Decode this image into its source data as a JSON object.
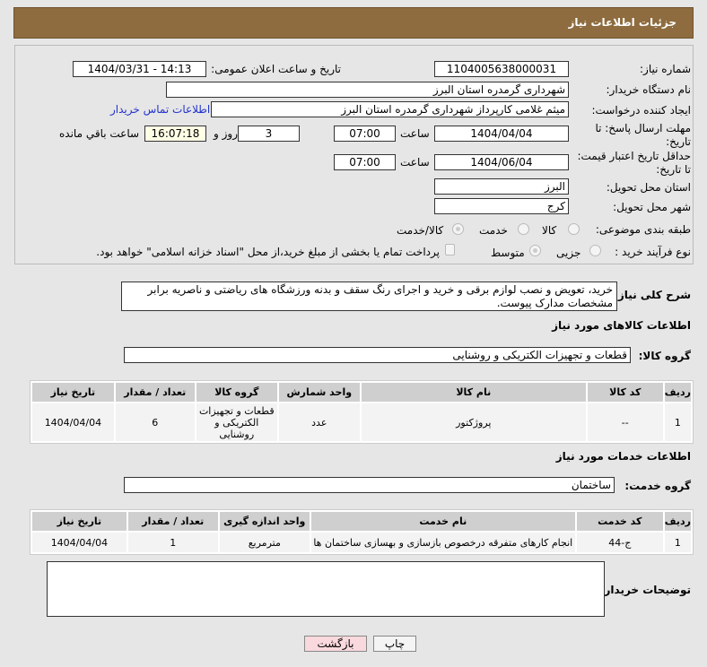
{
  "header": {
    "title": "جزئیات اطلاعات نیاز"
  },
  "form": {
    "need_number_label": "شماره نیاز:",
    "need_number": "1104005638000031",
    "announce_label": "تاریخ و ساعت اعلان عمومی:",
    "announce_value": "1404/03/31 - 14:13",
    "buyer_org_label": "نام دستگاه خریدار:",
    "buyer_org": "شهرداری گرمدره استان البرز",
    "creator_label": "ایجاد کننده درخواست:",
    "creator": "میثم غلامی کارپرداز شهرداری گرمدره استان البرز",
    "contact_link": "اطلاعات تماس خریدار",
    "reply_deadline_label": "مهلت ارسال پاسخ: تا تاریخ:",
    "reply_date": "1404/04/04",
    "time_label": "ساعت",
    "reply_time": "07:00",
    "days": "3",
    "days_label": "روز و",
    "remaining": "16:07:18",
    "remaining_label": "ساعت باقي مانده",
    "price_validity_label": "حداقل تاریخ اعتبار قیمت: تا تاریخ:",
    "price_date": "1404/06/04",
    "price_time": "07:00",
    "province_label": "استان محل تحویل:",
    "province": "البرز",
    "city_label": "شهر محل تحویل:",
    "city": "کرج",
    "category_label": "طبقه بندی موضوعی:",
    "category_options": [
      "کالا",
      "خدمت",
      "کالا/خدمت"
    ],
    "process_label": "نوع فرآیند خرید :",
    "process_options": [
      "جزیی",
      "متوسط"
    ],
    "payment_note": "پرداخت تمام یا بخشی از مبلغ خرید،از محل \"اسناد خزانه اسلامی\" خواهد بود.",
    "description_label": "شرح کلی نیاز:",
    "description": "خرید، تعویض و نصب لوازم برقی و خرید و اجرای رنگ سقف و بدنه ورزشگاه های ریاضتی و ناصریه برابر مشخصات مدارک پیوست."
  },
  "goods": {
    "title": "اطلاعات کالاهای مورد نیاز",
    "group_label": "گروه کالا:",
    "group": "قطعات و تجهیزات الکتریکی و روشنایی",
    "headers": [
      "ردیف",
      "کد کالا",
      "نام کالا",
      "واحد شمارش",
      "گروه کالا",
      "تعداد / مقدار",
      "تاریخ نیاز"
    ],
    "rows": [
      [
        "1",
        "--",
        "پروژکتور",
        "عدد",
        "قطعات و تجهیزات الکتریکی و روشنایی",
        "6",
        "1404/04/04"
      ]
    ]
  },
  "services": {
    "title": "اطلاعات خدمات مورد نیاز",
    "group_label": "گروه خدمت:",
    "group": "ساختمان",
    "headers": [
      "ردیف",
      "کد خدمت",
      "نام خدمت",
      "واحد اندازه گیری",
      "تعداد / مقدار",
      "تاریخ نیاز"
    ],
    "rows": [
      [
        "1",
        "ج-44",
        "انجام کارهای متفرقه درخصوص بازسازی و بهسازی ساختمان ها",
        "مترمربع",
        "1",
        "1404/04/04"
      ]
    ]
  },
  "buyer_notes_label": "توضیحات خریدار:",
  "buyer_notes": "",
  "buttons": {
    "print": "چاپ",
    "back": "بازگشت"
  }
}
